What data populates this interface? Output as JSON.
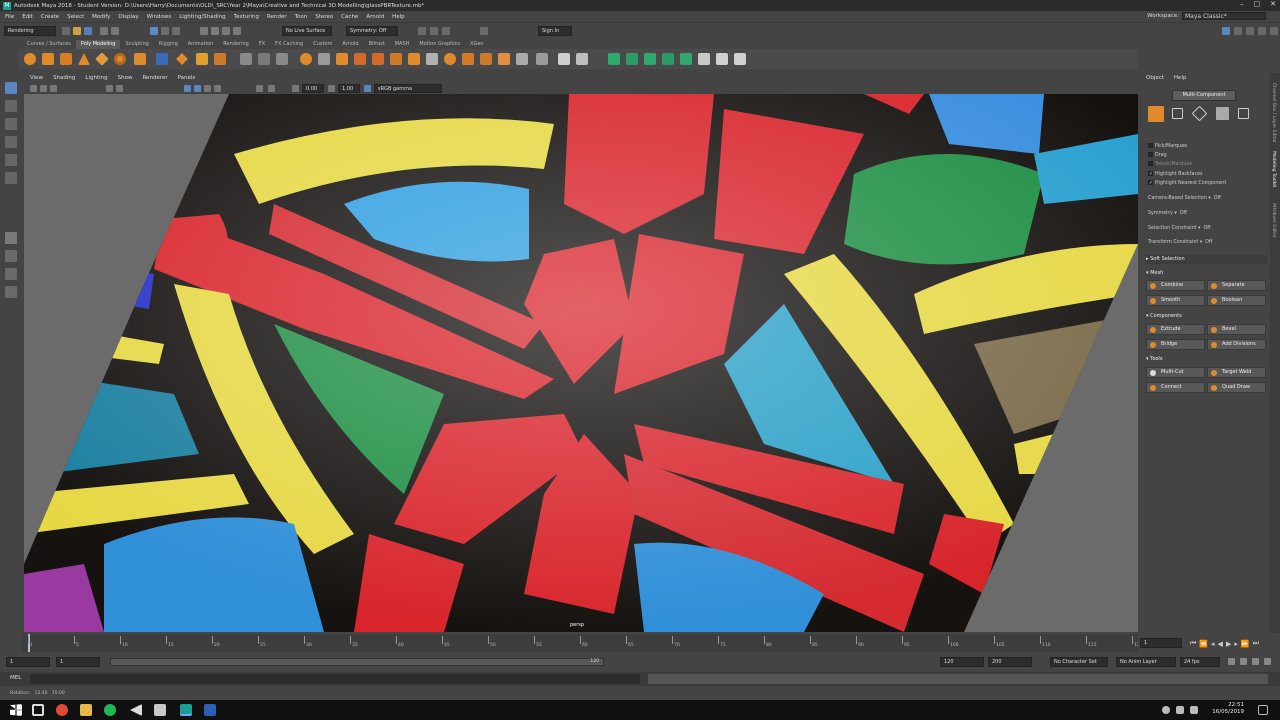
{
  "window": {
    "app_letter": "M",
    "title": "Autodesk Maya 2018 - Student Version: D:\\Users\\Harry\\Documents\\OLD\\_SRC\\Year 2\\Maya\\Creative and Technical 3D Modelling\\glassPBRTexture.mb*",
    "controls": [
      "–",
      "□",
      "✕"
    ]
  },
  "menubar": {
    "items": [
      "File",
      "Edit",
      "Create",
      "Select",
      "Modify",
      "Display",
      "Windows",
      "Lighting/Shading",
      "Texturing",
      "Render",
      "Toon",
      "Stereo",
      "Cache",
      "Arnold",
      "Help"
    ],
    "workspace_label": "Workspace:",
    "workspace_value": "Maya Classic*"
  },
  "statusline": {
    "menuset": "Rendering",
    "live_surface": "No Live Surface",
    "symmetry": "Symmetry: Off",
    "sign_in": "Sign In"
  },
  "shelf": {
    "tabs": [
      "Curves / Surfaces",
      "Poly Modeling",
      "Sculpting",
      "Rigging",
      "Animation",
      "Rendering",
      "FX",
      "FX Caching",
      "Custom",
      "Arnold",
      "Bifrost",
      "MASH",
      "Motion Graphics",
      "XGen"
    ],
    "active_tab": "Poly Modeling"
  },
  "viewport": {
    "menu": [
      "View",
      "Shading",
      "Lighting",
      "Show",
      "Renderer",
      "Panels"
    ],
    "exposure": "0.00",
    "gamma": "1.00",
    "color_space": "sRGB gamma",
    "camera_label": "persp"
  },
  "panel": {
    "menu": [
      "Object",
      "Help"
    ],
    "mode_button": "Multi-Component",
    "pick_options": [
      "Pick/Marquee",
      "Drag",
      "Tweak/Marquee",
      "Highlight Backfaces",
      "Highlight Nearest Component"
    ],
    "camera_based": "Camera-Based Selection",
    "camera_based_value": "Off",
    "symmetry": "Symmetry",
    "symmetry_value": "Off",
    "selection_constraint": "Selection Constraint",
    "selection_constraint_value": "Off",
    "transform_constraint": "Transform Constraint",
    "transform_constraint_value": "Off",
    "soft_selection": "Soft Selection",
    "mesh_head": "Mesh",
    "mesh_buttons": [
      "Combine",
      "Separate",
      "Smooth",
      "Boolean"
    ],
    "components_head": "Components",
    "components_buttons": [
      "Extrude",
      "Bevel",
      "Bridge",
      "Add Divisions"
    ],
    "tools_head": "Tools",
    "tools_buttons": [
      "Multi-Cut",
      "Target Weld",
      "Connect",
      "Quad Draw"
    ],
    "side_tabs": [
      "Channel Box / Layer Editor",
      "Modeling Toolkit",
      "Attribute Editor"
    ]
  },
  "timeline": {
    "ticks": [
      "1",
      "5",
      "10",
      "15",
      "20",
      "25",
      "30",
      "35",
      "40",
      "45",
      "50",
      "55",
      "60",
      "65",
      "70",
      "75",
      "80",
      "85",
      "90",
      "95",
      "100",
      "105",
      "110",
      "115",
      "120"
    ],
    "current_frame": "1"
  },
  "range": {
    "start": "1",
    "playback_start": "1",
    "range_end_inner": "120",
    "end": "120",
    "anim_end": "200",
    "character_set": "No Character Set",
    "anim_layer": "No Anim Layer",
    "fps": "24 fps"
  },
  "cmdline": {
    "lang": "MEL"
  },
  "helpline": {
    "text": "Rotation:   12.40   70.00"
  },
  "taskbar": {
    "time": "22:51",
    "date": "16/05/2019"
  },
  "colors": {
    "maya_bg": "#444444",
    "viewport_bg": "#6b6b6b",
    "accent_orange": "#e08a2c",
    "accent_teal": "#1a9e95",
    "glass_red": "#d8252c",
    "glass_yellow": "#e6d845",
    "glass_blue": "#2f8fd8",
    "glass_green": "#1f8f45",
    "lead_came": "#151210"
  }
}
